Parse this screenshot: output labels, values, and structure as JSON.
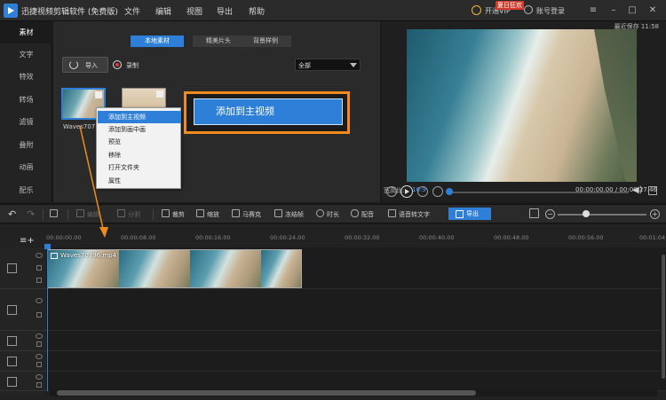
{
  "app": {
    "title": "迅捷视频剪辑软件 (免费版)"
  },
  "menu": [
    "文件",
    "编辑",
    "视图",
    "导出",
    "帮助"
  ],
  "header_right": {
    "vip_badge": "夏日狂欢",
    "vip_label": "开通VIP",
    "login": "账号登录"
  },
  "sidebar": [
    "素材",
    "文字",
    "特效",
    "转场",
    "滤镜",
    "叠附",
    "动画",
    "配乐"
  ],
  "media": {
    "tabs": [
      "本地素材",
      "精美片头",
      "背景样例"
    ],
    "import": "导入",
    "record": "录制",
    "filter": "全部",
    "item_name": "Waves707"
  },
  "context_menu": [
    "添加到主视频",
    "添加到画中画",
    "预览",
    "移除",
    "打开文件夹",
    "属性"
  ],
  "callout": "添加到主视频",
  "preview": {
    "save_time": "最近保存 11:58",
    "aspect_label": "宽高比:",
    "aspect_value": "16:9",
    "timecode": "00:00:00.00 / 00:00:27.46",
    "progress": 0
  },
  "toolbar": {
    "edit": "编辑",
    "split": "分割",
    "crop": "裁剪",
    "zoom": "缩放",
    "mosaic": "马赛克",
    "freeze": "冻结帧",
    "duration": "时长",
    "dub": "配音",
    "speech": "语音转文字",
    "export": "导出"
  },
  "timeline": {
    "ticks": [
      "00:00:00.00",
      "00:00:08.00",
      "00:00:16.00",
      "00:00:24.00",
      "00:00:32.00",
      "00:00:40.00",
      "00:00:48.00",
      "00:00:56.00",
      "00:01:04"
    ],
    "clip_name": "Waves70796.mp4"
  },
  "colors": {
    "accent": "#2e7fd8",
    "highlight": "#f08c1e"
  }
}
